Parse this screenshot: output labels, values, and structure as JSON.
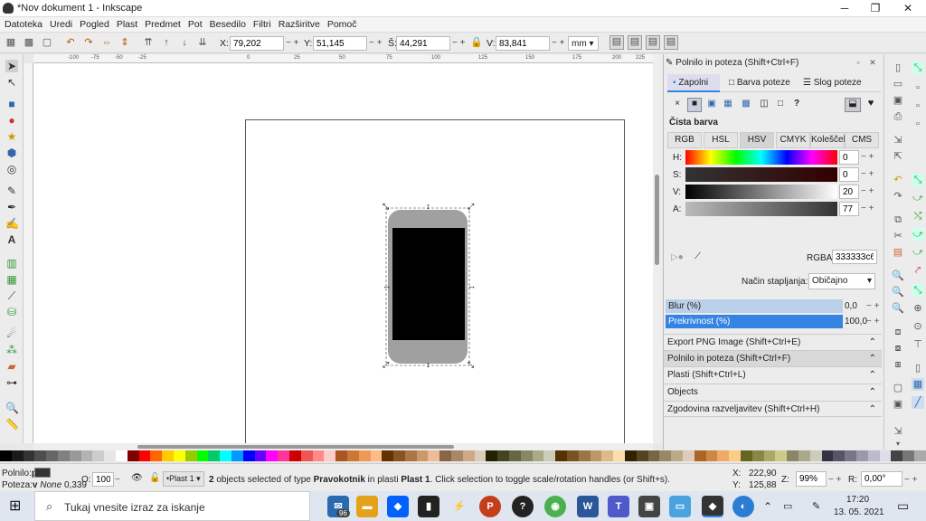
{
  "window": {
    "title": "*Nov dokument 1 - Inkscape",
    "min": "─",
    "max": "❐",
    "close": "✕"
  },
  "menu": [
    "Datoteka",
    "Uredi",
    "Pogled",
    "Plast",
    "Predmet",
    "Pot",
    "Besedilo",
    "Filtri",
    "Razširitve",
    "Pomoč"
  ],
  "toolbar": {
    "x_label": "X:",
    "x_value": "79,202",
    "y_label": "Y:",
    "y_value": "51,145",
    "w_label": "Š:",
    "w_value": "44,291",
    "h_label": "V:",
    "h_value": "83,841",
    "unit": "mm"
  },
  "ruler_labels": [
    "-100",
    "-75",
    "-50",
    "-25",
    "0",
    "25",
    "50",
    "75",
    "100",
    "125",
    "150",
    "175",
    "200",
    "225"
  ],
  "dock": {
    "header_title": "Polnilo in poteza",
    "header_shortcut": "(Shift+Ctrl+F)",
    "tabs": [
      "Zapolni",
      "Barva poteze",
      "Slog poteze"
    ],
    "active_tab": "Zapolni",
    "paint_types": [
      "×",
      "■",
      "▣",
      "▦",
      "▩",
      "◫",
      "□",
      "?"
    ],
    "flat_color_label": "Čista barva",
    "mode_tabs": [
      "RGB",
      "HSL",
      "HSV",
      "CMYK",
      "Kolešček",
      "CMS"
    ],
    "active_mode": "HSV",
    "channels": [
      {
        "label": "H:",
        "value": "0"
      },
      {
        "label": "S:",
        "value": "0"
      },
      {
        "label": "V:",
        "value": "20"
      },
      {
        "label": "A:",
        "value": "77"
      }
    ],
    "rgba_label": "RGBA:",
    "rgba_value": "333333c6",
    "blend_label": "Način stapljanja:",
    "blend_value": "Običajno",
    "blur_label": "Blur (%)",
    "blur_value": "0,0",
    "opacity_label": "Prekrivnost (%)",
    "opacity_value": "100,0",
    "panels": [
      "Export PNG Image (Shift+Ctrl+E)",
      "Polnilo in poteza  (Shift+Ctrl+F)",
      "Plasti  (Shift+Ctrl+L)",
      "Objects",
      "Zgodovina razveljavitev  (Shift+Ctrl+H)"
    ]
  },
  "status": {
    "fill_label": "Polnilo:",
    "fill_value": "p",
    "stroke_label": "Poteza:",
    "stroke_value": "v",
    "stroke_none": "None",
    "stroke_width": "0,339",
    "o_label": "O:",
    "o_value": "100",
    "layer": "•Plast 1",
    "message_count": "2",
    "message_pre": " objects selected of type ",
    "message_type": "Pravokotnik",
    "message_mid": " in plasti ",
    "message_layer": "Plast 1",
    "message_post": ". Click selection to toggle scale/rotation handles (or Shift+s).",
    "x_label": "X:",
    "x_value": "222,90",
    "y_label": "Y:",
    "y_value": "125,88",
    "z_label": "Z:",
    "z_value": "99%",
    "r_label": "R:",
    "r_value": "0,00°"
  },
  "taskbar": {
    "search_placeholder": "Tukaj vnesite izraz za iskanje",
    "time": "17:20",
    "date": "13. 05. 2021",
    "badge": "96"
  },
  "colors": {
    "accent": "#3584e4",
    "black": "#000000",
    "gray": "#a0a0a0"
  }
}
